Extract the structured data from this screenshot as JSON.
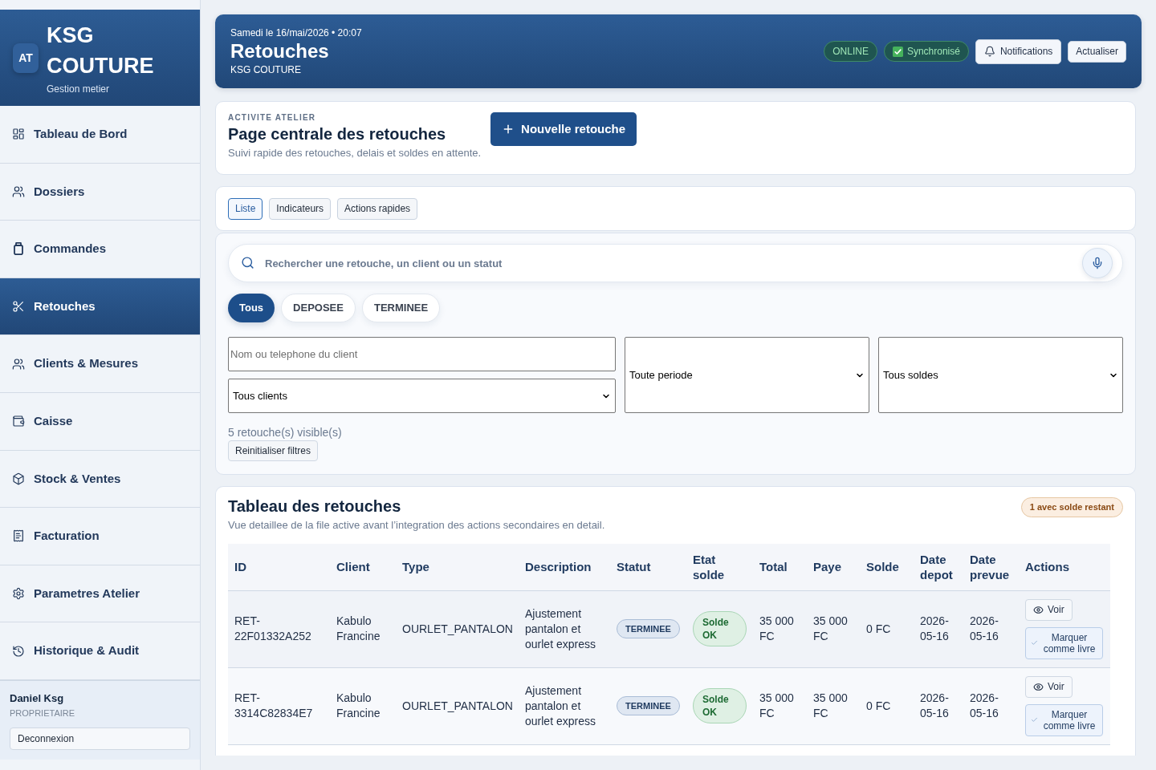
{
  "sidebar": {
    "logo": "AT",
    "brand": "KSG COUTURE",
    "tagline": "Gestion metier",
    "items": [
      {
        "label": "Tableau de Bord",
        "selected": false
      },
      {
        "label": "Dossiers",
        "selected": false
      },
      {
        "label": "Commandes",
        "selected": false
      },
      {
        "label": "Retouches",
        "selected": true
      },
      {
        "label": "Clients & Mesures",
        "selected": false
      },
      {
        "label": "Caisse",
        "selected": false
      },
      {
        "label": "Stock & Ventes",
        "selected": false
      },
      {
        "label": "Facturation",
        "selected": false
      },
      {
        "label": "Parametres Atelier",
        "selected": false
      },
      {
        "label": "Historique & Audit",
        "selected": false
      }
    ],
    "user": {
      "name": "Daniel Ksg",
      "role": "PROPRIETAIRE",
      "logout_button": "Deconnexion"
    }
  },
  "header": {
    "date": "Samedi le 16/mai/2026 • 20:07",
    "title": "Retouches",
    "subtitle": "KSG COUTURE",
    "status_pills": [
      "ONLINE",
      "Synchronisé"
    ],
    "buttons": [
      "Notifications",
      "Actualiser"
    ]
  },
  "intro": {
    "eyebrow": "ACTIVITE ATELIER",
    "title": "Page centrale des retouches",
    "subtitle": "Suivi rapide des retouches, delais et soldes en attente.",
    "button": "Nouvelle retouche"
  },
  "tabs": [
    {
      "label": "Liste",
      "selected": true
    },
    {
      "label": "Indicateurs",
      "selected": false
    },
    {
      "label": "Actions rapides",
      "selected": false
    }
  ],
  "filters": {
    "search": {
      "placeholder": "Rechercher une retouche, un client ou un statut"
    },
    "status_chips": [
      {
        "label": "Tous",
        "selected": true
      },
      {
        "label": "DEPOSEE",
        "selected": false
      },
      {
        "label": "TERMINEE",
        "selected": false
      }
    ],
    "client_search": {
      "placeholder": "Nom ou telephone du client"
    },
    "client_select": "Tous clients",
    "period_select": "Toute periode",
    "balance_select": "Tous soldes",
    "count": "5 retouche(s) visible(s)",
    "reset_button": "Reinitialiser filtres"
  },
  "table": {
    "title": "Tableau des retouches",
    "subtitle": "Vue detaillee de la file active avant l’integration des actions secondaires en detail.",
    "badge": "1 avec solde restant",
    "columns": [
      "ID",
      "Client",
      "Type",
      "Description",
      "Statut",
      "Etat solde",
      "Total",
      "Paye",
      "Solde",
      "Date depot",
      "Date prevue",
      "Actions"
    ],
    "rows": [
      {
        "id": "RET-22F01332A252",
        "client": "Kabulo Francine",
        "type": "OURLET_PANTALON",
        "description": "Ajustement pantalon et ourlet express",
        "status": "TERMINEE",
        "balance_state": "Solde OK",
        "total": "35 000 FC",
        "paid": "35 000 FC",
        "balance": "0 FC",
        "date_deposit": "2026-05-16",
        "date_due": "2026-05-16",
        "actions": [
          "Voir",
          "Marquer comme livre"
        ]
      },
      {
        "id": "RET-3314C82834E7",
        "client": "Kabulo Francine",
        "type": "OURLET_PANTALON",
        "description": "Ajustement pantalon et ourlet express",
        "status": "TERMINEE",
        "balance_state": "Solde OK",
        "total": "35 000 FC",
        "paid": "35 000 FC",
        "balance": "0 FC",
        "date_deposit": "2026-05-16",
        "date_due": "2026-05-16",
        "actions": [
          "Voir",
          "Marquer comme livre"
        ]
      }
    ]
  }
}
